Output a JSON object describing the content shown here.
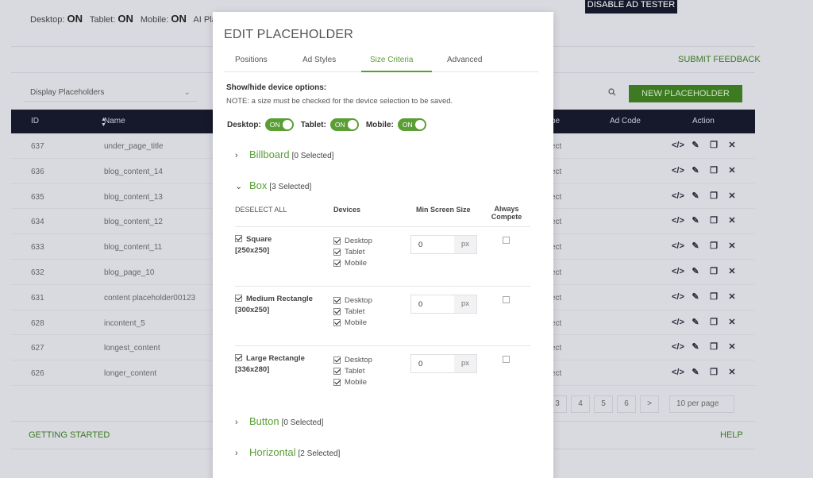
{
  "background": {
    "device_status": [
      {
        "label": "Desktop:",
        "value": "ON"
      },
      {
        "label": "Tablet:",
        "value": "ON"
      },
      {
        "label": "Mobile:",
        "value": "ON"
      },
      {
        "label": "AI Plac",
        "value": ""
      }
    ],
    "disable_button": "DISABLE AD TESTER",
    "submit_feedback": "SUBMIT FEEDBACK",
    "select_label": "Display Placeholders",
    "new_button": "NEW PLACEHOLDER",
    "table": {
      "headers": {
        "id": "ID",
        "name": "Name",
        "type": "pe",
        "ad_code": "Ad Code",
        "action": "Action"
      },
      "rows": [
        {
          "id": "637",
          "name": "under_page_title",
          "type": "ect"
        },
        {
          "id": "636",
          "name": "blog_content_14",
          "type": "ect"
        },
        {
          "id": "635",
          "name": "blog_content_13",
          "type": "ect"
        },
        {
          "id": "634",
          "name": "blog_content_12",
          "type": "ect"
        },
        {
          "id": "633",
          "name": "blog_content_11",
          "type": "ect"
        },
        {
          "id": "632",
          "name": "blog_page_10",
          "type": "ect"
        },
        {
          "id": "631",
          "name": "content placeholder00123",
          "type": "ect"
        },
        {
          "id": "628",
          "name": "incontent_5",
          "type": "ect"
        },
        {
          "id": "627",
          "name": "longest_content",
          "type": "ect"
        },
        {
          "id": "626",
          "name": "longer_content",
          "type": "ect"
        }
      ]
    },
    "pager": [
      "3",
      "4",
      "5",
      "6",
      ">"
    ],
    "per_page": "10 per page",
    "getting_started": "GETTING STARTED",
    "help": "HELP"
  },
  "modal": {
    "title": "EDIT PLACEHOLDER",
    "tabs": [
      "Positions",
      "Ad Styles",
      "Size Criteria",
      "Advanced"
    ],
    "active_tab": "Size Criteria",
    "section_title": "Show/hide device options:",
    "section_note": "NOTE: a size must be checked for the device selection to be saved.",
    "device_toggles": [
      {
        "label": "Desktop:",
        "state": "ON"
      },
      {
        "label": "Tablet:",
        "state": "ON"
      },
      {
        "label": "Mobile:",
        "state": "ON"
      }
    ],
    "groups": {
      "billboard": {
        "name": "Billboard",
        "count": "[0 Selected]"
      },
      "box": {
        "name": "Box",
        "count": "[3 Selected]"
      },
      "button": {
        "name": "Button",
        "count": "[0 Selected]"
      },
      "horizontal": {
        "name": "Horizontal",
        "count": "[2 Selected]"
      }
    },
    "box_headers": {
      "deselect": "DESELECT ALL",
      "devices": "Devices",
      "min_screen": "Min Screen Size",
      "always_compete": "Always Compete"
    },
    "sizes": [
      {
        "name": "Square",
        "dim": "[250x250]",
        "devices": [
          "Desktop",
          "Tablet",
          "Mobile"
        ],
        "min_value": "0",
        "unit": "px"
      },
      {
        "name": "Medium Rectangle",
        "dim": "[300x250]",
        "devices": [
          "Desktop",
          "Tablet",
          "Mobile"
        ],
        "min_value": "0",
        "unit": "px"
      },
      {
        "name": "Large Rectangle",
        "dim": "[336x280]",
        "devices": [
          "Desktop",
          "Tablet",
          "Mobile"
        ],
        "min_value": "0",
        "unit": "px"
      }
    ]
  }
}
